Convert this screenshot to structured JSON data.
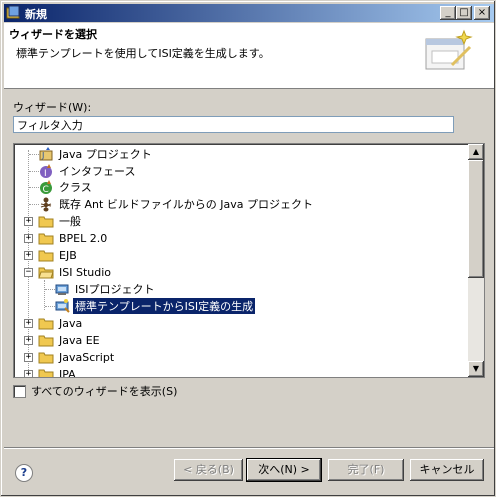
{
  "window": {
    "title": "新規"
  },
  "header": {
    "title": "ウィザードを選択",
    "description": "標準テンプレートを使用してISI定義を生成します。"
  },
  "wizard_label": "ウィザード(W):",
  "filter": {
    "value": "フィルタ入力"
  },
  "tree": {
    "items": [
      {
        "label": "Java プロジェクト",
        "icon": "java-project-icon"
      },
      {
        "label": "インタフェース",
        "icon": "interface-icon"
      },
      {
        "label": "クラス",
        "icon": "class-icon"
      },
      {
        "label": "既存 Ant ビルドファイルからの Java プロジェクト",
        "icon": "ant-icon"
      },
      {
        "label": "一般",
        "icon": "folder-icon"
      },
      {
        "label": "BPEL 2.0",
        "icon": "folder-icon"
      },
      {
        "label": "EJB",
        "icon": "folder-icon"
      },
      {
        "label": "ISI Studio",
        "icon": "folder-open-icon"
      },
      {
        "label": "ISIプロジェクト",
        "icon": "isi-project-icon"
      },
      {
        "label": "標準テンプレートからISI定義の生成",
        "icon": "isi-template-icon"
      },
      {
        "label": "Java",
        "icon": "folder-icon"
      },
      {
        "label": "Java EE",
        "icon": "folder-icon"
      },
      {
        "label": "JavaScript",
        "icon": "folder-icon"
      },
      {
        "label": "JPA",
        "icon": "folder-icon"
      }
    ]
  },
  "show_all_label": "すべてのウィザードを表示(S)",
  "buttons": {
    "back": "< 戻る(B)",
    "next": "次へ(N) >",
    "finish": "完了(F)",
    "cancel": "キャンセル"
  },
  "help_glyph": "?"
}
